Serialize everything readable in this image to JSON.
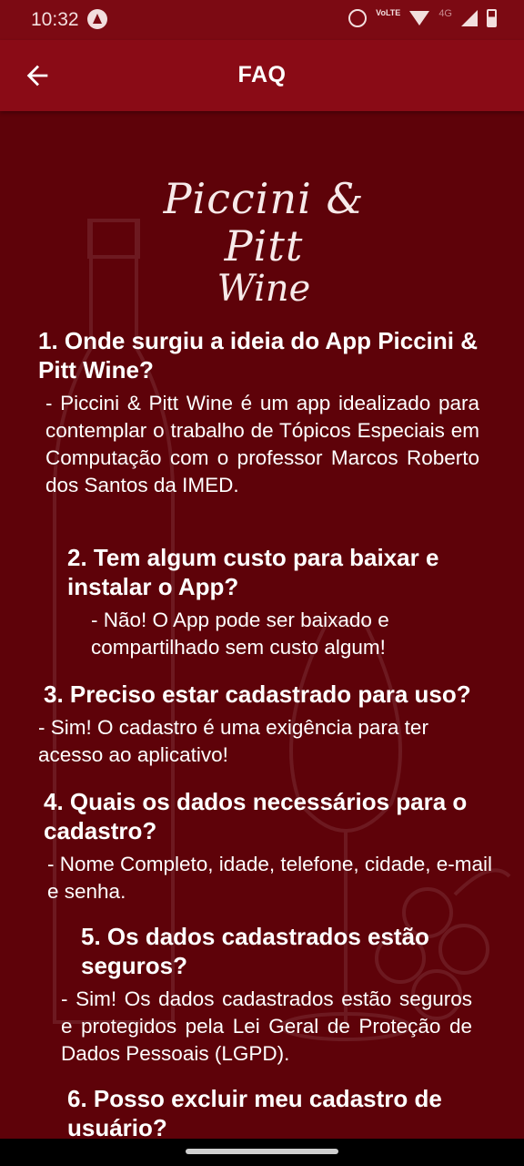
{
  "status_bar": {
    "time": "10:32",
    "lte_label": "VoLTE",
    "network_label": "4G",
    "icons": [
      "app-icon",
      "alarm-icon",
      "lte-icon",
      "wifi-icon",
      "signal-icon",
      "battery-icon"
    ]
  },
  "app_bar": {
    "title": "FAQ",
    "back_icon": "arrow-left-icon"
  },
  "logo": {
    "line1": "Piccini & Pitt",
    "line2": "Wine"
  },
  "faq": [
    {
      "question": "1. Onde surgiu a ideia do App Piccini & Pitt Wine?",
      "answer": "- Piccini & Pitt Wine é um app idealizado para contemplar o trabalho de Tópicos Especiais em Computação com o professor Marcos Roberto dos Santos da IMED."
    },
    {
      "question": "2. Tem algum custo para baixar e instalar o App?",
      "answer": "- Não!  O App pode ser baixado e compartilhado sem custo algum!"
    },
    {
      "question": "3. Preciso estar cadastrado para uso?",
      "answer": "- Sim!  O cadastro é uma exigência para ter acesso ao aplicativo!"
    },
    {
      "question": "4. Quais os dados necessários para o cadastro?",
      "answer": "- Nome Completo, idade, telefone, cidade, e-mail e senha."
    },
    {
      "question": "5. Os dados cadastrados estão seguros?",
      "answer": "- Sim!  Os dados cadastrados estão seguros e protegidos pela Lei Geral de Proteção de Dados Pessoais (LGPD)."
    },
    {
      "question": "6. Posso excluir meu cadastro de usuário?",
      "answer": ""
    }
  ],
  "colors": {
    "background": "#5e0209",
    "app_bar": "#8a0b16",
    "status_bar": "#7c0a13",
    "text": "#ffffff"
  }
}
